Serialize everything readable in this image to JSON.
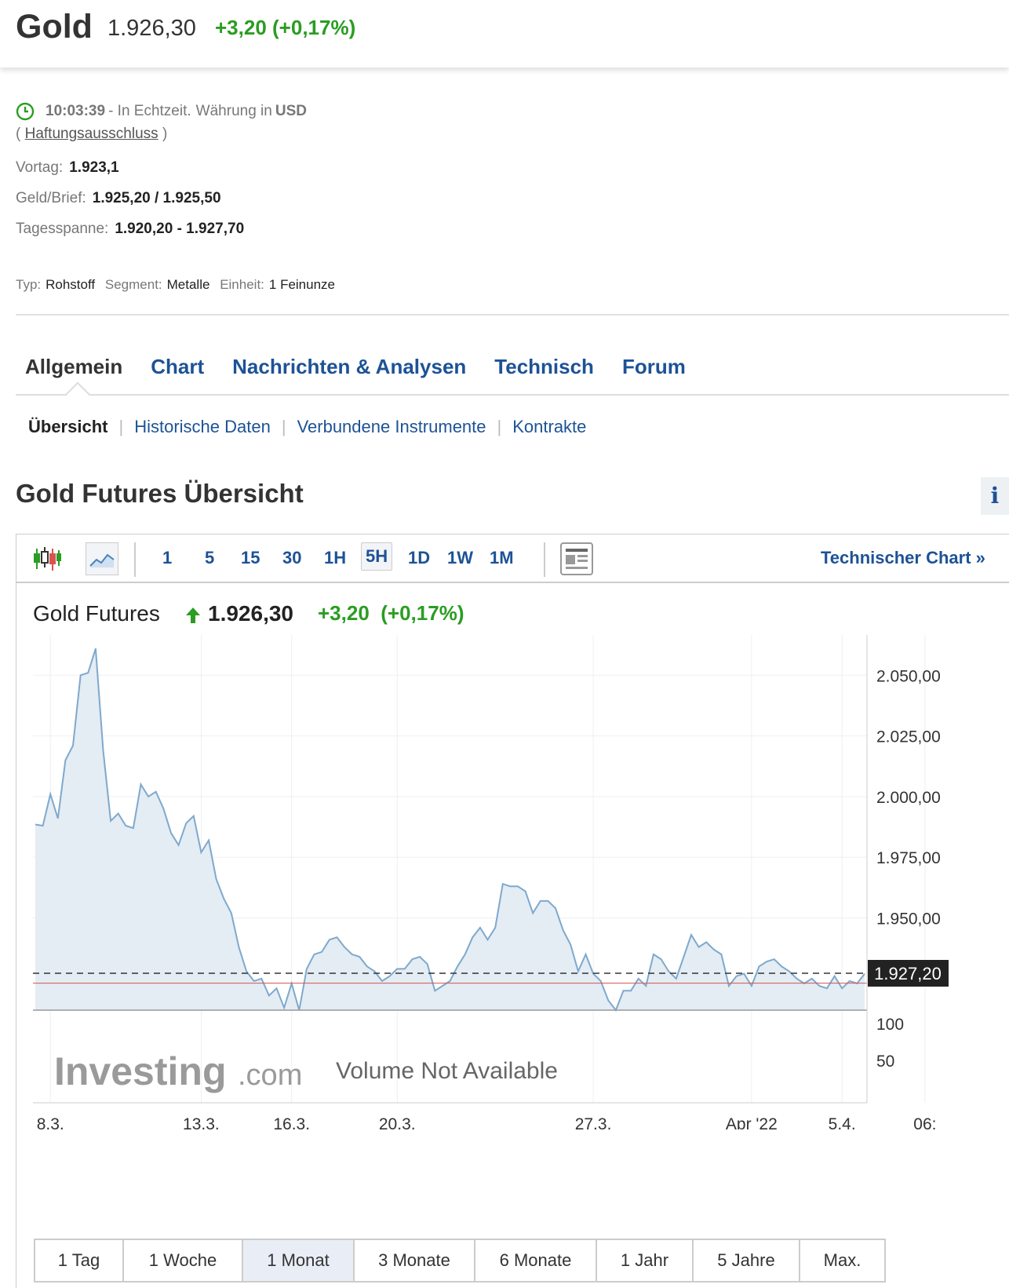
{
  "header": {
    "title": "Gold",
    "price": "1.926,30",
    "change": "+3,20 (+0,17%)"
  },
  "status": {
    "time": "10:03:39",
    "realtime": "- In Echtzeit.",
    "currency_label": "Währung in",
    "currency": "USD",
    "disclaimer_open": "(",
    "disclaimer": "Haftungsausschluss",
    "disclaimer_close": ")"
  },
  "quote": {
    "prev_label": "Vortag:",
    "prev_value": "1.923,1",
    "bidask_label": "Geld/Brief:",
    "bidask_value": "1.925,20 / 1.925,50",
    "range_label": "Tagesspanne:",
    "range_value": "1.920,20 - 1.927,70"
  },
  "meta": {
    "type_label": "Typ:",
    "type_value": "Rohstoff",
    "segment_label": "Segment:",
    "segment_value": "Metalle",
    "unit_label": "Einheit:",
    "unit_value": "1 Feinunze"
  },
  "tabs": [
    "Allgemein",
    "Chart",
    "Nachrichten & Analysen",
    "Technisch",
    "Forum"
  ],
  "subtabs": [
    "Übersicht",
    "Historische Daten",
    "Verbundene Instrumente",
    "Kontrakte"
  ],
  "section_title": "Gold Futures Übersicht",
  "info_button": "i",
  "toolbar": {
    "timeframes": [
      "1",
      "5",
      "15",
      "30",
      "1H",
      "5H",
      "1D",
      "1W",
      "1M"
    ],
    "active_timeframe": "5H",
    "tech_chart": "Technischer Chart »"
  },
  "chart_widget": {
    "title": "Gold Futures",
    "price": "1.926,30",
    "change": "+3,20",
    "change_pct": "(+0,17%)",
    "volume_message": "Volume Not Available",
    "watermark_main": "Investing",
    "watermark_suffix": ".com",
    "current_label": "1.927,20"
  },
  "chart_data": {
    "type": "area",
    "ylim": [
      1912,
      2064
    ],
    "yticks": [
      {
        "value": 2050,
        "label": "2.050,00"
      },
      {
        "value": 2025,
        "label": "2.025,00"
      },
      {
        "value": 2000,
        "label": "2.000,00"
      },
      {
        "value": 1975,
        "label": "1.975,00"
      },
      {
        "value": 1950,
        "label": "1.950,00"
      }
    ],
    "current_value": 1927.2,
    "reference_value": 1923.1,
    "volume_ticks": [
      "100",
      "50"
    ],
    "xticks": [
      {
        "index": 2,
        "label": "8.3."
      },
      {
        "index": 22,
        "label": "13.3."
      },
      {
        "index": 34,
        "label": "16.3."
      },
      {
        "index": 48,
        "label": "20.3."
      },
      {
        "index": 74,
        "label": "27.3."
      },
      {
        "index": 95,
        "label": "Apr '22"
      },
      {
        "index": 107,
        "label": "5.4."
      },
      {
        "index": 118,
        "label": "06:"
      }
    ],
    "values": [
      1988.5,
      1988,
      2001,
      1991,
      2015,
      2021,
      2050,
      2051,
      2061,
      2019,
      1990,
      1993,
      1988,
      1987,
      2005,
      2000,
      2002,
      1995,
      1985,
      1980,
      1989,
      1992,
      1977,
      1982,
      1966,
      1958,
      1952,
      1938,
      1928,
      1924,
      1925,
      1918,
      1921,
      1913,
      1923,
      1912,
      1929,
      1935,
      1936,
      1941,
      1942,
      1938,
      1935,
      1934,
      1930,
      1928,
      1924,
      1926,
      1929,
      1929,
      1933,
      1934,
      1931,
      1920,
      1922,
      1924,
      1930,
      1935,
      1942,
      1946,
      1941,
      1946,
      1964,
      1963,
      1963,
      1961,
      1952,
      1957,
      1957,
      1954,
      1945,
      1939,
      1928,
      1935,
      1927,
      1924,
      1916,
      1912,
      1920,
      1920,
      1925,
      1922,
      1935,
      1933,
      1928,
      1925,
      1934,
      1943,
      1938,
      1940,
      1937,
      1935,
      1922,
      1926,
      1927,
      1922,
      1930,
      1932,
      1933,
      1930,
      1928,
      1925,
      1923,
      1925,
      1922,
      1921,
      1926,
      1921,
      1924,
      1923,
      1927
    ]
  },
  "ranges": [
    "1 Tag",
    "1 Woche",
    "1 Monat",
    "3 Monate",
    "6 Monate",
    "1 Jahr",
    "5 Jahre",
    "Max."
  ],
  "active_range": "1 Monat",
  "colors": {
    "accent": "#1d5296",
    "positive": "#2a9d22",
    "line": "#7ea9cc",
    "area": "#e4ecf4",
    "reference": "#d9534f"
  }
}
